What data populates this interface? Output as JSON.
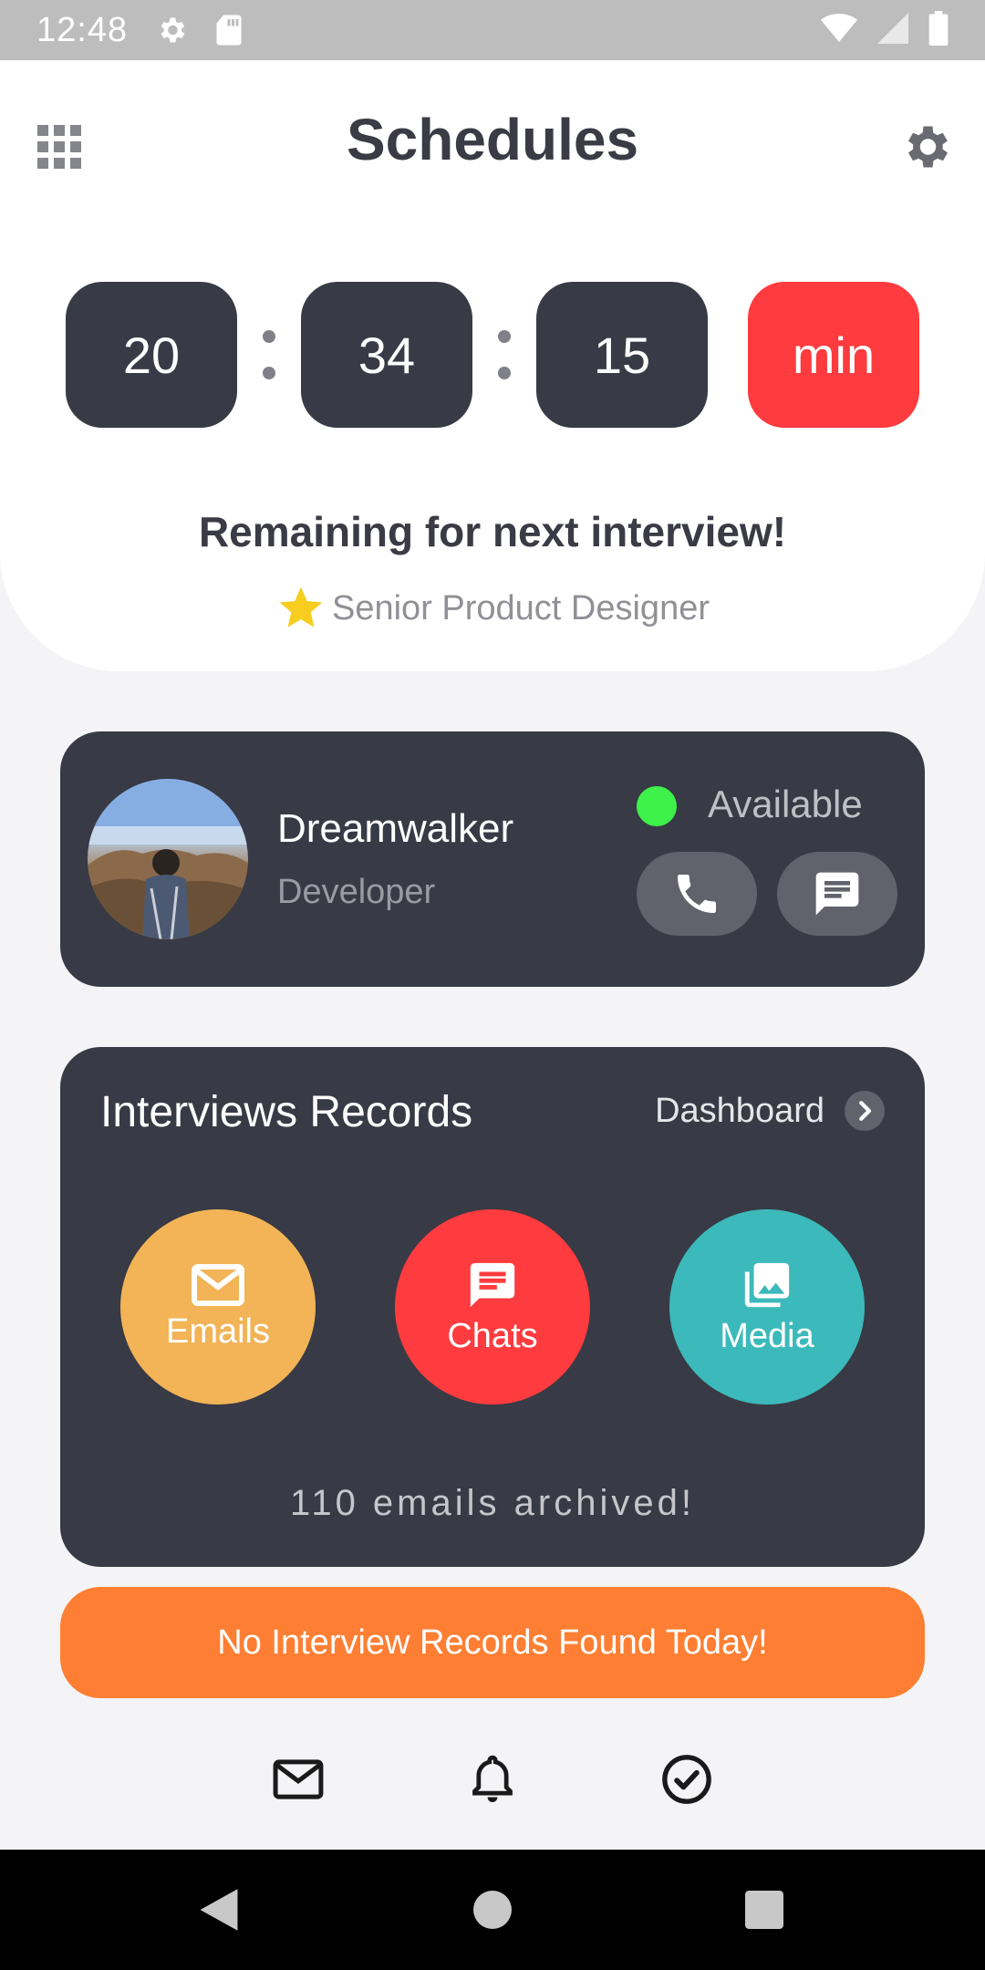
{
  "status_bar": {
    "time": "12:48",
    "icons": [
      "settings-icon",
      "sd-card-icon",
      "wifi-icon",
      "signal-icon",
      "battery-icon"
    ]
  },
  "header": {
    "title": "Schedules",
    "left_icon": "apps-grid-icon",
    "right_icon": "gear-icon"
  },
  "timer": {
    "hours": "20",
    "minutes": "34",
    "seconds": "15",
    "unit": "min",
    "caption": "Remaining for next interview!",
    "role": "Senior Product Designer"
  },
  "profile": {
    "name": "Dreamwalker",
    "role": "Developer",
    "status": "Available",
    "status_color": "#3ef04a"
  },
  "records": {
    "title": "Interviews Records",
    "link_label": "Dashboard",
    "items": [
      {
        "label": "Emails",
        "icon": "mail-icon",
        "color": "#f2b457"
      },
      {
        "label": "Chats",
        "icon": "chat-icon",
        "color": "#fe3b3e"
      },
      {
        "label": "Media",
        "icon": "gallery-icon",
        "color": "#3cb9bb"
      }
    ],
    "summary": "110 emails archived!"
  },
  "banner": {
    "text": "No Interview Records Found Today!",
    "color": "#fe7f33"
  },
  "bottom_tabs": [
    "mail-icon",
    "bell-icon",
    "check-circle-icon"
  ],
  "colors": {
    "dark_card": "#383a45",
    "accent_red": "#fe3b3e"
  }
}
